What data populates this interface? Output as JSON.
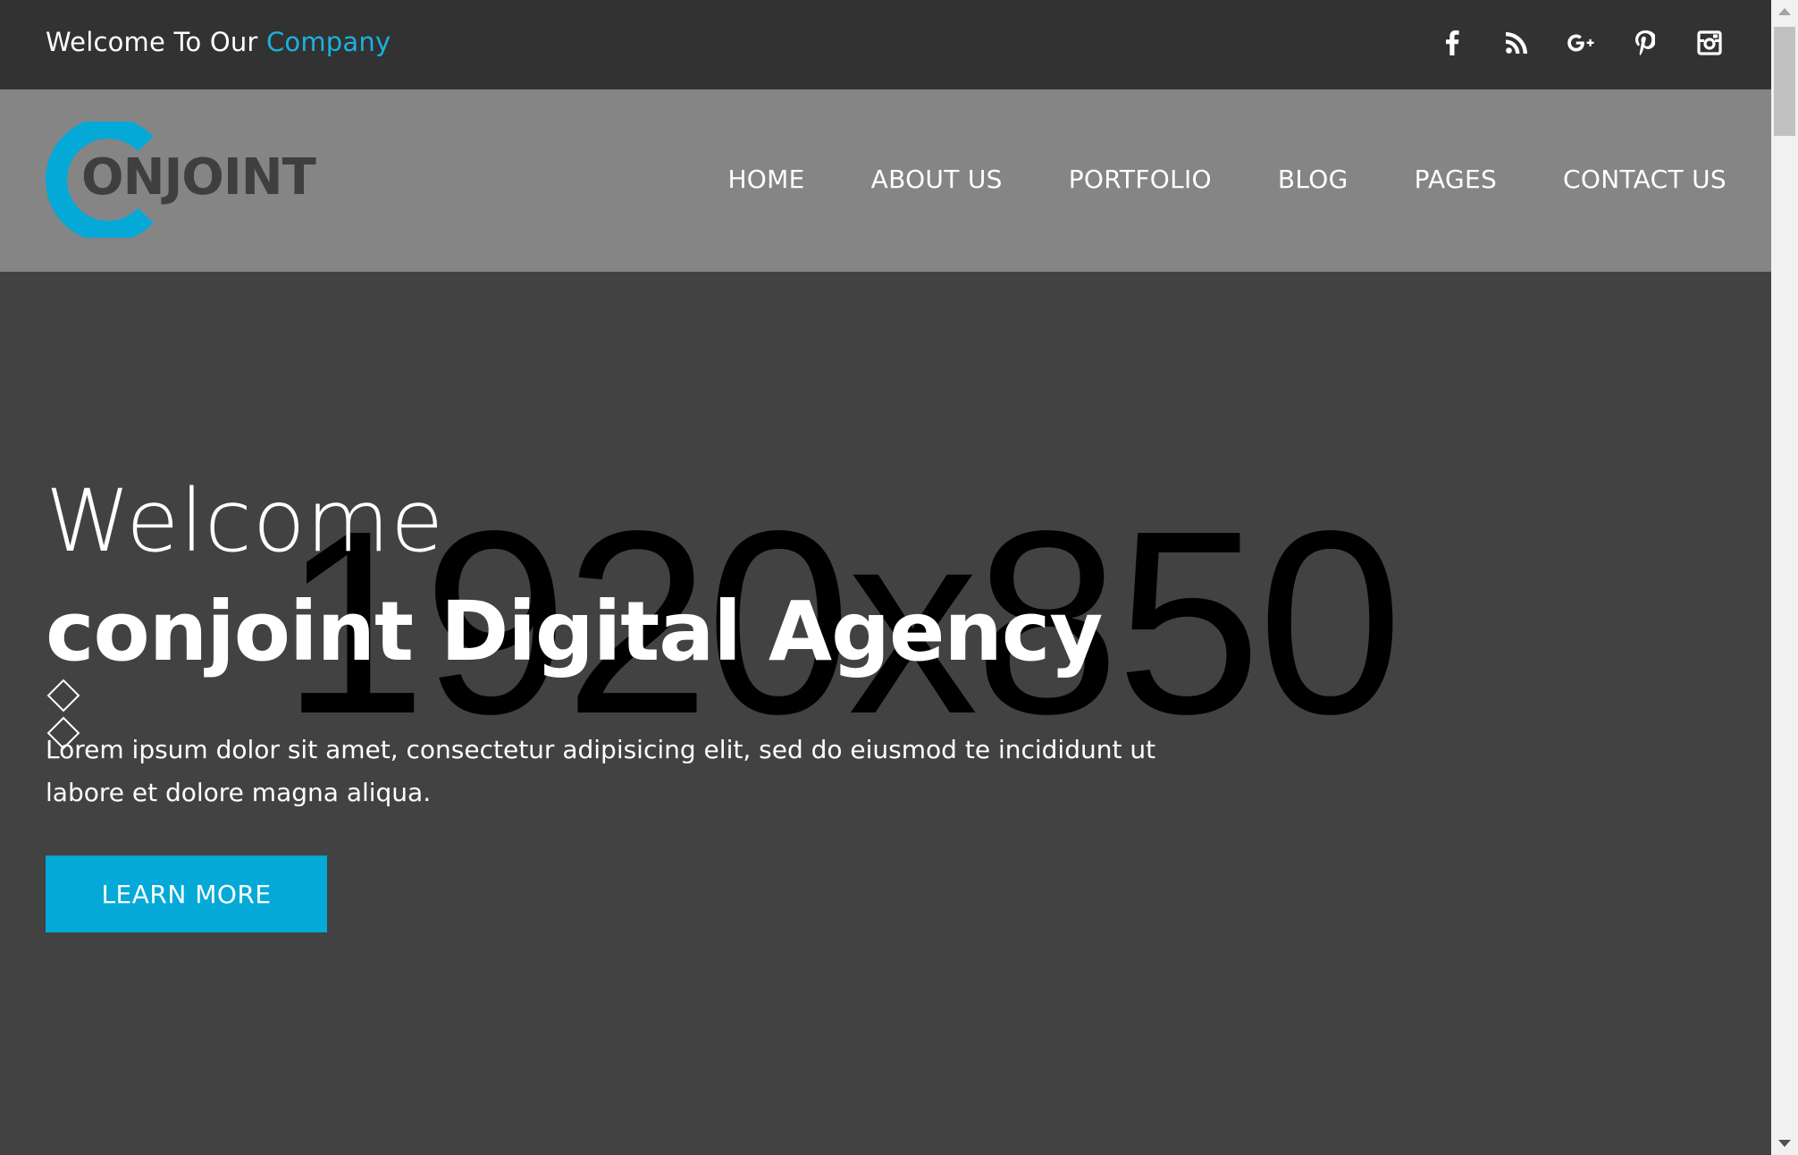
{
  "topbar": {
    "welcome_prefix": "Welcome To Our ",
    "welcome_accent": "Company",
    "accent_color": "#1ab1e0",
    "social_icons": [
      "facebook-icon",
      "rss-icon",
      "google-plus-icon",
      "pinterest-icon",
      "instagram-icon"
    ]
  },
  "header": {
    "logo_text": "ONJOINT",
    "logo_color": "#04a9d8",
    "nav": [
      "HOME",
      "ABOUT US",
      "PORTFOLIO",
      "BLOG",
      "PAGES",
      "CONTACT US"
    ]
  },
  "hero": {
    "placeholder_text": "1920x850",
    "title_line1": "Welcome",
    "title_line2": "conjoint Digital Agency",
    "description": "Lorem ipsum dolor sit amet, consectetur adipisicing elit, sed do eiusmod te incididunt ut labore et dolore magna aliqua.",
    "button_label": "LEARN MORE",
    "button_color": "#04a9d8"
  }
}
